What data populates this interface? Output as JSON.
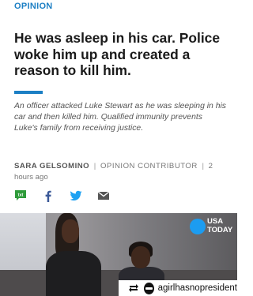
{
  "article": {
    "section": "OPINION",
    "headline": "He was asleep in his car. Police woke him up and created a reason to kill him.",
    "summary": "An officer attacked Luke Stewart as he was sleeping in his car and then killed him. Qualified immunity prevents Luke's family from receiving justice.",
    "author": "SARA GELSOMINO",
    "separator": "|",
    "role": "OPINION CONTRIBUTOR",
    "timestamp": "2 hours ago"
  },
  "share": {
    "icons": [
      "txt-message-icon",
      "facebook-icon",
      "twitter-icon",
      "email-icon"
    ],
    "txt_label": "txt"
  },
  "video": {
    "brand_line1": "USA",
    "brand_line2": "TODAY"
  },
  "repost": {
    "username": "agirlhasnopresident"
  },
  "colors": {
    "accent": "#1c7fc4",
    "brand": "#1c9cf0",
    "facebook": "#3b5998",
    "twitter": "#1da1f2",
    "sms": "#2e9b3a"
  }
}
